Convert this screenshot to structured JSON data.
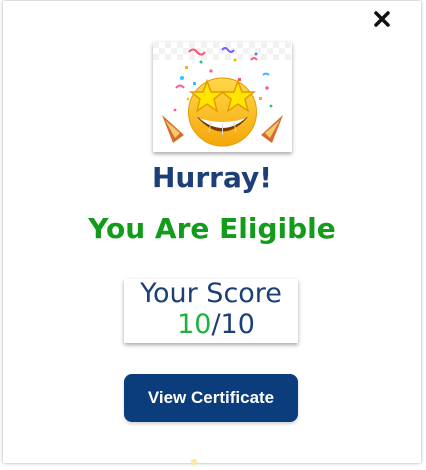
{
  "dialog": {
    "title": "Hurray!",
    "eligibility_message": "You Are Eligible",
    "score": {
      "label": "Your Score",
      "current": "10",
      "separator": "/",
      "total": "10"
    },
    "primary_button_label": "View Certificate"
  },
  "icons": {
    "close": "close-icon",
    "celebration": "star-struck-emoji-icon"
  },
  "colors": {
    "primary": "#0b3c7b",
    "heading": "#1c3f77",
    "success": "#139b1c",
    "score_accent": "#1db23a"
  }
}
